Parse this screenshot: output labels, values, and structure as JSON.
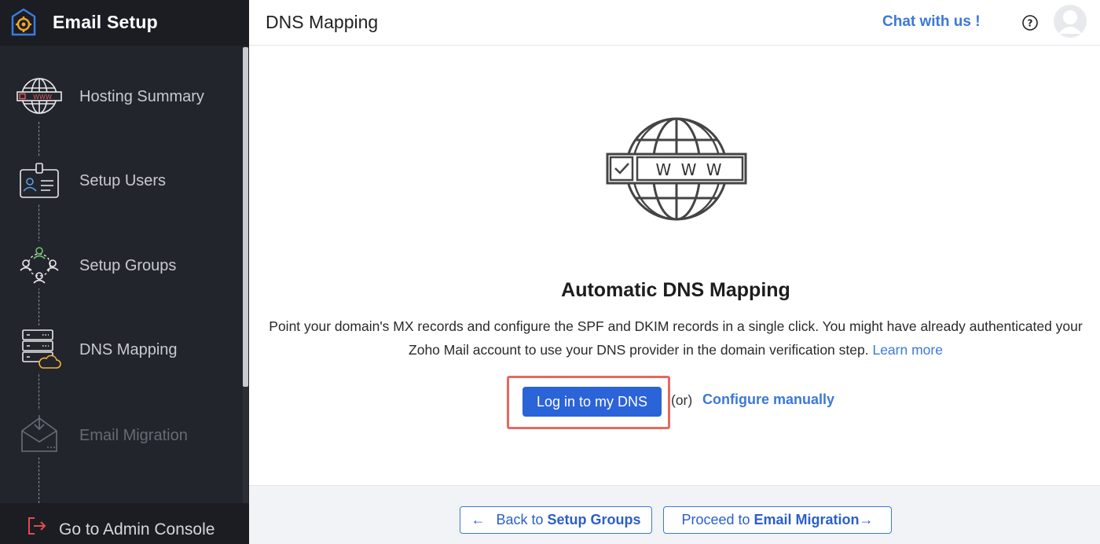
{
  "sidebar": {
    "title": "Email Setup",
    "steps": [
      {
        "label": "Hosting Summary",
        "icon": "www-globe-icon"
      },
      {
        "label": "Setup Users",
        "icon": "user-card-icon"
      },
      {
        "label": "Setup Groups",
        "icon": "group-icon"
      },
      {
        "label": "DNS Mapping",
        "icon": "server-cloud-icon"
      },
      {
        "label": "Email Migration",
        "icon": "inbox-download-icon"
      }
    ],
    "footer": {
      "label": "Go to Admin Console",
      "icon": "exit-icon"
    }
  },
  "header": {
    "title": "DNS Mapping",
    "chat_label": "Chat with us !",
    "help_icon": "question-circle-icon",
    "avatar_icon": "user-avatar-icon"
  },
  "main": {
    "illustration": {
      "www_text": "W W W",
      "icon": "globe-www-icon"
    },
    "heading": "Automatic DNS Mapping",
    "desc_line1": "Point your domain's MX records and configure the SPF and DKIM records in a single click. You might have already authenticated your",
    "desc_line2": "Zoho Mail account to use your DNS provider in the domain verification step.",
    "learn_more": "Learn more",
    "primary_button": "Log in to my DNS",
    "or_text": "(or)",
    "manual_link": "Configure manually"
  },
  "footer": {
    "back_prefix": "Back to",
    "back_target": "Setup Groups",
    "next_prefix": "Proceed to",
    "next_target": "Email Migration",
    "back_arrow": "←",
    "next_arrow": "→"
  },
  "colors": {
    "sidebar_bg": "#23252c",
    "accent": "#3c78d8",
    "primary_button": "#2b63d8",
    "highlight": "#e46a5e"
  }
}
